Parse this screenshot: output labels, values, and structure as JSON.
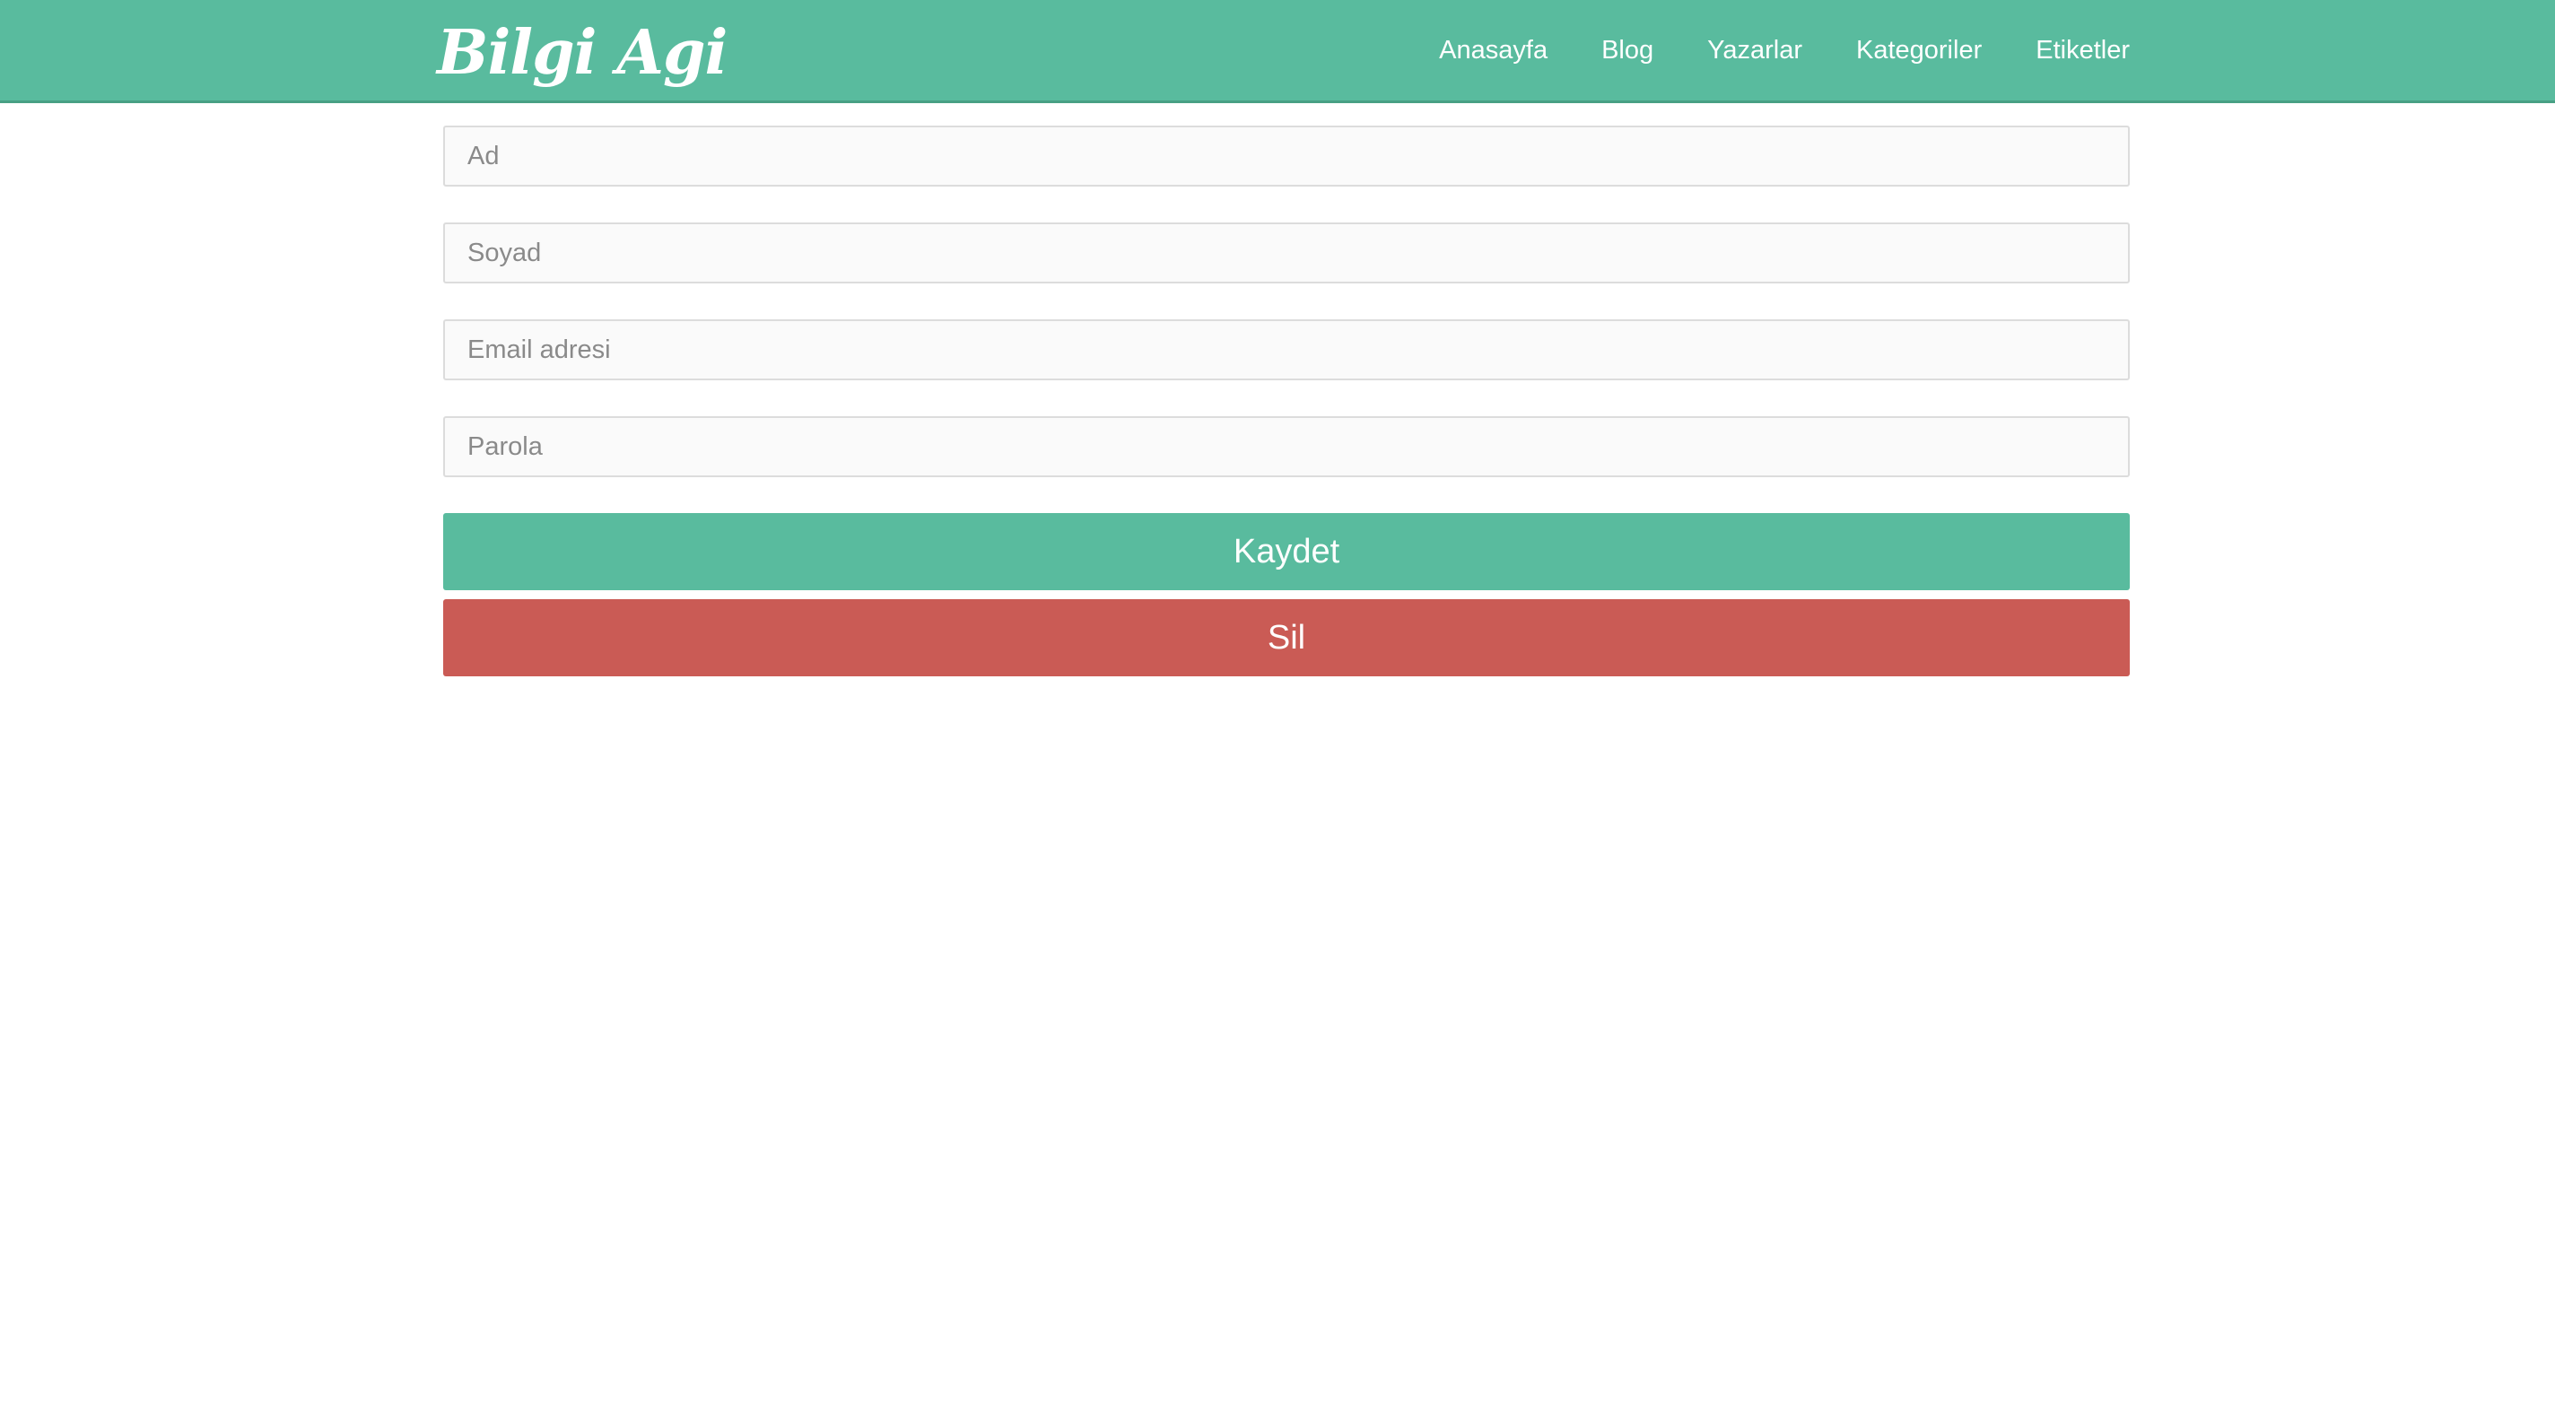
{
  "header": {
    "brand": "Bilgi Agi",
    "nav": [
      {
        "label": "Anasayfa"
      },
      {
        "label": "Blog"
      },
      {
        "label": "Yazarlar"
      },
      {
        "label": "Kategoriler"
      },
      {
        "label": "Etiketler"
      }
    ]
  },
  "form": {
    "first_name": {
      "placeholder": "Ad",
      "value": ""
    },
    "last_name": {
      "placeholder": "Soyad",
      "value": ""
    },
    "email": {
      "placeholder": "Email adresi",
      "value": ""
    },
    "password": {
      "placeholder": "Parola",
      "value": ""
    },
    "save_label": "Kaydet",
    "delete_label": "Sil"
  },
  "colors": {
    "primary": "#59bb9e",
    "danger": "#ca5b55",
    "input_border": "#dcdcdc",
    "input_background": "#fafafa"
  }
}
